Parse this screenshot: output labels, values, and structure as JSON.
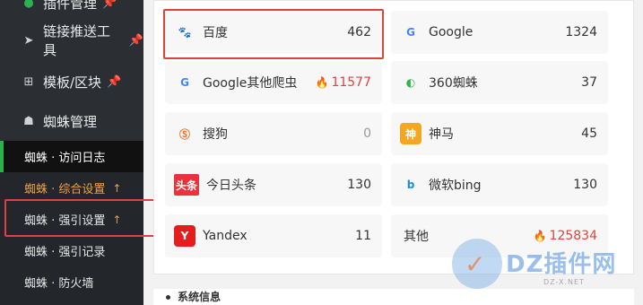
{
  "sidebar": {
    "items": [
      {
        "label": "插件管理",
        "icon": "plugin-icon",
        "pinned": true
      },
      {
        "label": "链接推送工具",
        "icon": "send-icon",
        "pinned": true
      },
      {
        "label": "模板/区块",
        "icon": "windows-icon",
        "pinned": true
      },
      {
        "label": "蜘蛛管理",
        "icon": "android-icon",
        "pinned": false
      }
    ],
    "subitems": [
      {
        "label": "蜘蛛 · 访问日志"
      },
      {
        "label": "蜘蛛 · 综合设置",
        "arrow": "↑"
      },
      {
        "label": "蜘蛛 · 强引设置",
        "arrow": "↑"
      },
      {
        "label": "蜘蛛 · 强引记录"
      },
      {
        "label": "蜘蛛 · 防火墙"
      }
    ]
  },
  "spiders": [
    {
      "name": "百度",
      "count": "462",
      "logo": "baidu-icon"
    },
    {
      "name": "Google",
      "count": "1324",
      "logo": "google-icon"
    },
    {
      "name": "Google其他爬虫",
      "count": "11577",
      "logo": "google-icon",
      "hot": true
    },
    {
      "name": "360蜘蛛",
      "count": "37",
      "logo": "360-icon"
    },
    {
      "name": "搜狗",
      "count": "0",
      "logo": "sogou-icon"
    },
    {
      "name": "神马",
      "count": "45",
      "logo": "shenma-icon"
    },
    {
      "name": "今日头条",
      "count": "130",
      "logo": "toutiao-icon",
      "logo_text": "头条"
    },
    {
      "name": "微软bing",
      "count": "130",
      "logo": "bing-icon"
    },
    {
      "name": "Yandex",
      "count": "11",
      "logo": "yandex-icon"
    },
    {
      "name": "其他",
      "count": "125834",
      "logo": null,
      "hot": true
    }
  ],
  "section": {
    "title": "系统信息"
  },
  "watermark": {
    "brand": "DZ插件网",
    "url": "DZ-X.NET"
  },
  "colors": {
    "highlight_red": "#d9453e",
    "hot": "#d9453e",
    "sidebar_bg": "#2b2f33"
  }
}
